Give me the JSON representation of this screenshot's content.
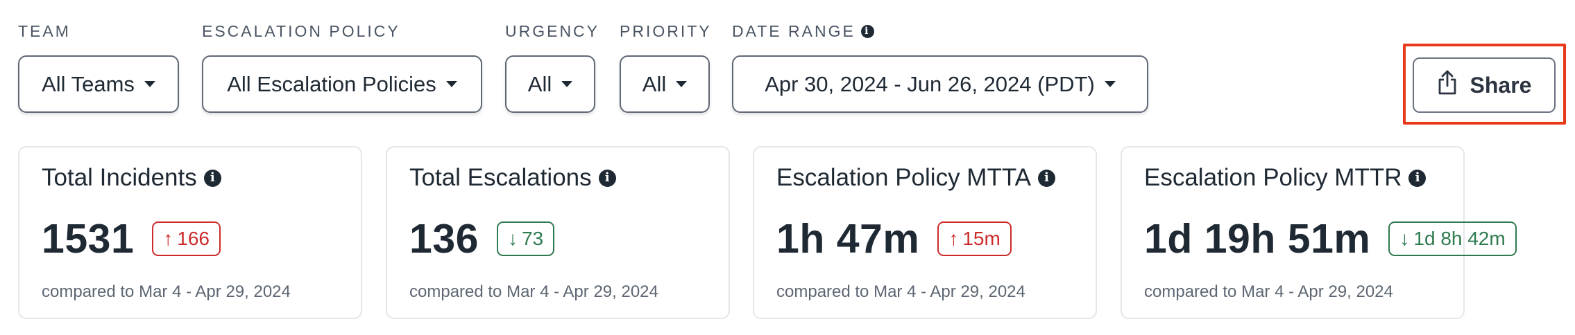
{
  "filters": {
    "team": {
      "label": "TEAM",
      "value": "All Teams"
    },
    "escalation_policy": {
      "label": "ESCALATION POLICY",
      "value": "All Escalation Policies"
    },
    "urgency": {
      "label": "URGENCY",
      "value": "All"
    },
    "priority": {
      "label": "PRIORITY",
      "value": "All"
    },
    "date_range": {
      "label": "DATE RANGE",
      "value": "Apr 30, 2024 - Jun 26, 2024 (PDT)",
      "info_icon": "info-icon"
    }
  },
  "share": {
    "label": "Share",
    "icon": "share-icon",
    "highlight_color": "#e8391b"
  },
  "cards": [
    {
      "title": "Total Incidents",
      "value": "1531",
      "delta": "166",
      "direction": "up",
      "compare": "compared to Mar 4 - Apr 29, 2024"
    },
    {
      "title": "Total Escalations",
      "value": "136",
      "delta": "73",
      "direction": "down",
      "compare": "compared to Mar 4 - Apr 29, 2024"
    },
    {
      "title": "Escalation Policy MTTA",
      "value": "1h 47m",
      "delta": "15m",
      "direction": "up",
      "compare": "compared to Mar 4 - Apr 29, 2024"
    },
    {
      "title": "Escalation Policy MTTR",
      "value": "1d 19h 51m",
      "delta": "1d 8h 42m",
      "direction": "down",
      "compare": "compared to Mar 4 - Apr 29, 2024"
    }
  ],
  "colors": {
    "up": "#cc2b2b",
    "down": "#2e7a4f",
    "text": "#1f2933"
  }
}
